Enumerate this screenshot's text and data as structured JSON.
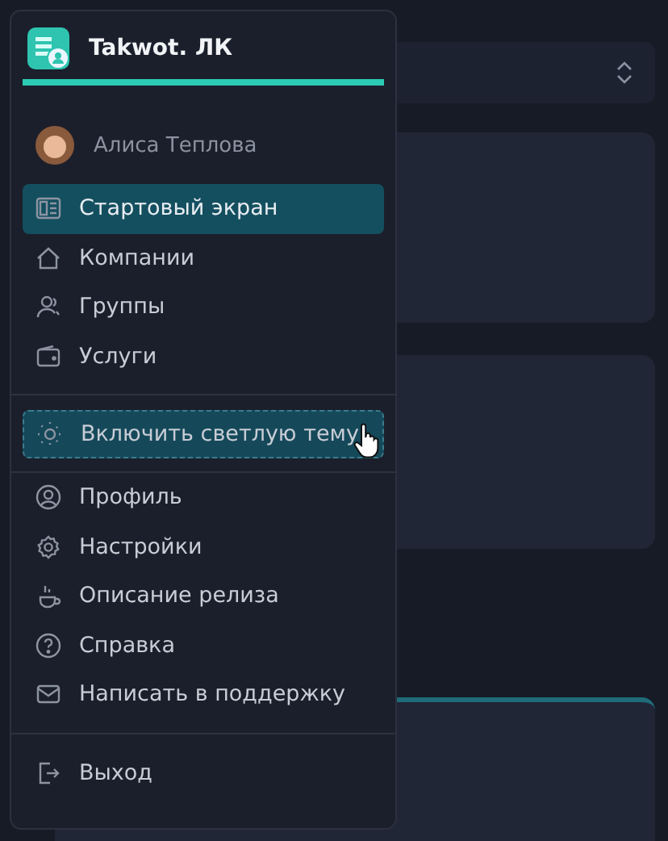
{
  "app": {
    "title": "Takwot. ЛК"
  },
  "user": {
    "name": "Алиса Теплова"
  },
  "nav_items": [
    {
      "label": "Стартовый экран",
      "selected": true
    },
    {
      "label": "Компании",
      "selected": false
    },
    {
      "label": "Группы",
      "selected": false
    },
    {
      "label": "Услуги",
      "selected": false
    }
  ],
  "theme_toggle": {
    "label": "Включить светлую тему"
  },
  "account_items": [
    {
      "label": "Профиль"
    },
    {
      "label": "Настройки"
    },
    {
      "label": "Описание релиза"
    },
    {
      "label": "Справка"
    },
    {
      "label": "Написать в поддержку"
    }
  ],
  "logout": {
    "label": "Выход"
  }
}
